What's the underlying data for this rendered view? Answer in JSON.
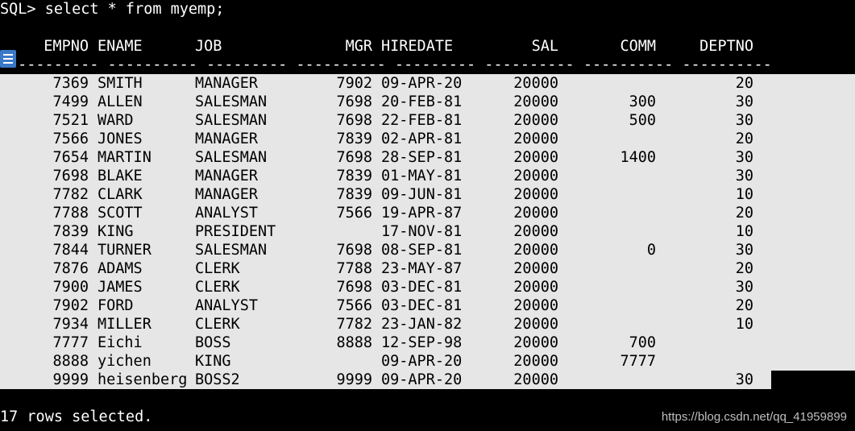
{
  "terminal": {
    "command_line": "SQL> select * from myemp;",
    "footer": "17 rows selected.",
    "watermark": "https://blog.csdn.net/qq_41959899"
  },
  "table": {
    "headers": {
      "empno": "EMPNO",
      "ename": "ENAME",
      "job": "JOB",
      "mgr": "MGR",
      "hiredate": "HIREDATE",
      "sal": "SAL",
      "comm": "COMM",
      "deptno": "DEPTNO"
    },
    "separator": "---------- ---------- --------- ---------- --------- ---------- ---------- ----------",
    "rows": [
      {
        "empno": "7369",
        "ename": "SMITH",
        "job": "MANAGER",
        "mgr": "7902",
        "hiredate": "09-APR-20",
        "sal": "20000",
        "comm": "",
        "deptno": "20"
      },
      {
        "empno": "7499",
        "ename": "ALLEN",
        "job": "SALESMAN",
        "mgr": "7698",
        "hiredate": "20-FEB-81",
        "sal": "20000",
        "comm": "300",
        "deptno": "30"
      },
      {
        "empno": "7521",
        "ename": "WARD",
        "job": "SALESMAN",
        "mgr": "7698",
        "hiredate": "22-FEB-81",
        "sal": "20000",
        "comm": "500",
        "deptno": "30"
      },
      {
        "empno": "7566",
        "ename": "JONES",
        "job": "MANAGER",
        "mgr": "7839",
        "hiredate": "02-APR-81",
        "sal": "20000",
        "comm": "",
        "deptno": "20"
      },
      {
        "empno": "7654",
        "ename": "MARTIN",
        "job": "SALESMAN",
        "mgr": "7698",
        "hiredate": "28-SEP-81",
        "sal": "20000",
        "comm": "1400",
        "deptno": "30"
      },
      {
        "empno": "7698",
        "ename": "BLAKE",
        "job": "MANAGER",
        "mgr": "7839",
        "hiredate": "01-MAY-81",
        "sal": "20000",
        "comm": "",
        "deptno": "30"
      },
      {
        "empno": "7782",
        "ename": "CLARK",
        "job": "MANAGER",
        "mgr": "7839",
        "hiredate": "09-JUN-81",
        "sal": "20000",
        "comm": "",
        "deptno": "10"
      },
      {
        "empno": "7788",
        "ename": "SCOTT",
        "job": "ANALYST",
        "mgr": "7566",
        "hiredate": "19-APR-87",
        "sal": "20000",
        "comm": "",
        "deptno": "20"
      },
      {
        "empno": "7839",
        "ename": "KING",
        "job": "PRESIDENT",
        "mgr": "",
        "hiredate": "17-NOV-81",
        "sal": "20000",
        "comm": "",
        "deptno": "10"
      },
      {
        "empno": "7844",
        "ename": "TURNER",
        "job": "SALESMAN",
        "mgr": "7698",
        "hiredate": "08-SEP-81",
        "sal": "20000",
        "comm": "0",
        "deptno": "30"
      },
      {
        "empno": "7876",
        "ename": "ADAMS",
        "job": "CLERK",
        "mgr": "7788",
        "hiredate": "23-MAY-87",
        "sal": "20000",
        "comm": "",
        "deptno": "20"
      },
      {
        "empno": "7900",
        "ename": "JAMES",
        "job": "CLERK",
        "mgr": "7698",
        "hiredate": "03-DEC-81",
        "sal": "20000",
        "comm": "",
        "deptno": "30"
      },
      {
        "empno": "7902",
        "ename": "FORD",
        "job": "ANALYST",
        "mgr": "7566",
        "hiredate": "03-DEC-81",
        "sal": "20000",
        "comm": "",
        "deptno": "20"
      },
      {
        "empno": "7934",
        "ename": "MILLER",
        "job": "CLERK",
        "mgr": "7782",
        "hiredate": "23-JAN-82",
        "sal": "20000",
        "comm": "",
        "deptno": "10"
      },
      {
        "empno": "7777",
        "ename": "Eichi",
        "job": "BOSS",
        "mgr": "8888",
        "hiredate": "12-SEP-98",
        "sal": "20000",
        "comm": "700",
        "deptno": ""
      },
      {
        "empno": "8888",
        "ename": "yichen",
        "job": "KING",
        "mgr": "",
        "hiredate": "09-APR-20",
        "sal": "20000",
        "comm": "7777",
        "deptno": ""
      },
      {
        "empno": "9999",
        "ename": "heisenberg",
        "job": "BOSS2",
        "mgr": "9999",
        "hiredate": "09-APR-20",
        "sal": "20000",
        "comm": "",
        "deptno": "30"
      }
    ]
  },
  "icons": {
    "left_edge": "document-lines-icon"
  },
  "colors": {
    "terminal_background": "#000000",
    "terminal_text": "#ffffff",
    "selection_background": "#e6e6e6",
    "selection_text": "#000000"
  }
}
